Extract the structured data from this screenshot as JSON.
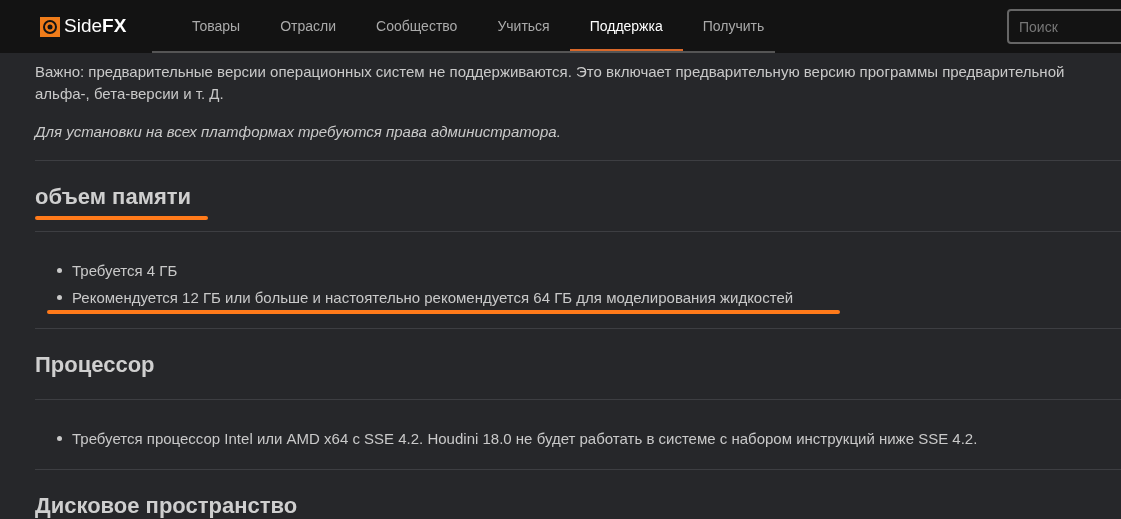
{
  "header": {
    "logo": "Side**FX**",
    "nav": [
      {
        "label": "Товары",
        "selected": false
      },
      {
        "label": "Отрасли",
        "selected": false
      },
      {
        "label": "Сообщество",
        "selected": false
      },
      {
        "label": "Учиться",
        "selected": false
      },
      {
        "label": "Поддержка",
        "selected": true
      },
      {
        "label": "Получить",
        "selected": false
      }
    ],
    "search": {
      "placeholder": "Поиск"
    }
  },
  "intro": {
    "lines": [
      "Важно: предварительные версии операционных систем не поддерживаются. Это включает предварительную версию программы предварительной",
      "альфа-, бета-версии и т. Д."
    ],
    "note": "Для установки на всех платформах требуются права администратора."
  },
  "sections": [
    {
      "heading": "объем памяти",
      "marked": true,
      "items": [
        {
          "text": "Требуется 4 ГБ",
          "marked": false
        },
        {
          "text": "Рекомендуется 12 ГБ или больше и настоятельно рекомендуется 64 ГБ для моделирования жидкостей",
          "marked": true
        }
      ]
    },
    {
      "heading": "Процессор",
      "marked": false,
      "items": [
        {
          "text": "Требуется процессор Intel или AMD x64 с SSE 4.2. Houdini 18.0 не будет работать в системе с набором инструкций ниже SSE 4.2.",
          "marked": false
        }
      ]
    },
    {
      "heading": "Дисковое пространство",
      "marked": false
    }
  ]
}
